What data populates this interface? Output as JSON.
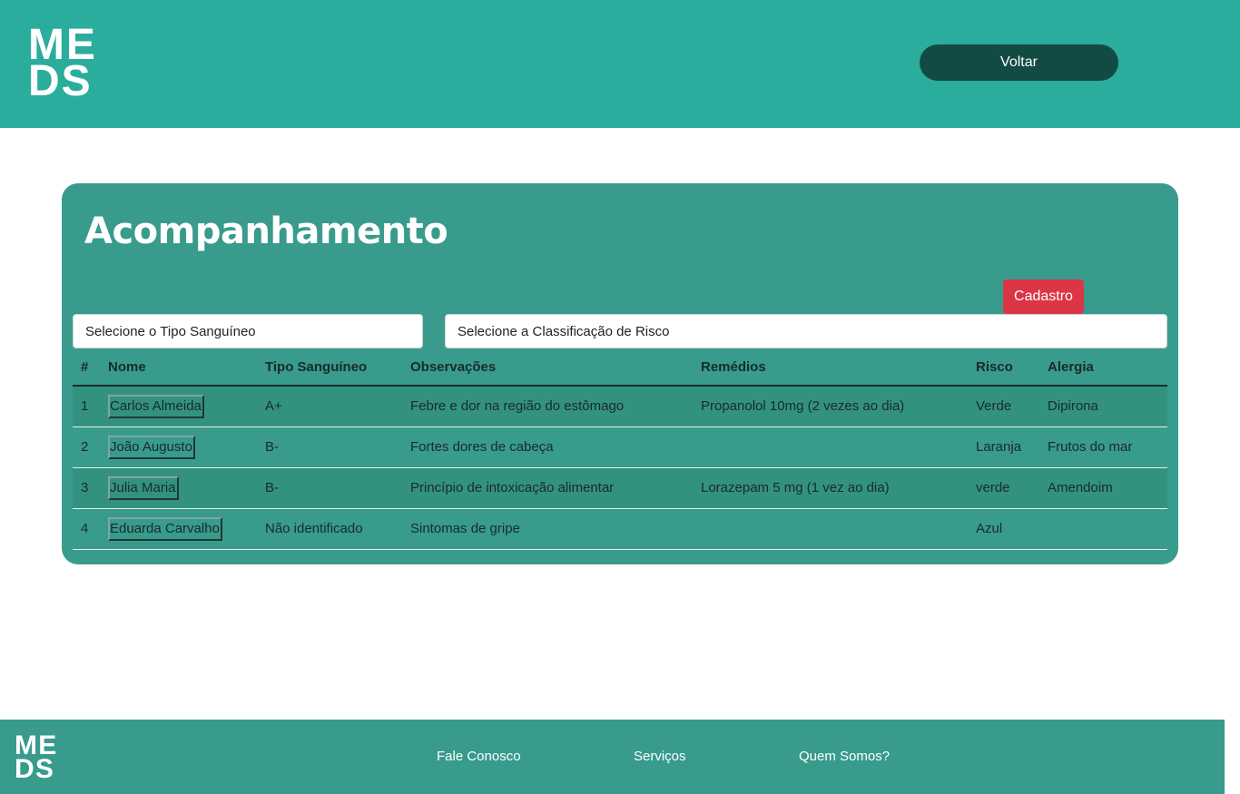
{
  "header": {
    "logo_line1": "ME",
    "logo_line2": "DS",
    "back_label": "Voltar"
  },
  "panel": {
    "title": "Acompanhamento",
    "register_label": "Cadastro",
    "blood_select_value": "Selecione o Tipo Sanguíneo",
    "risk_select_value": "Selecione a Classificação de Risco"
  },
  "table": {
    "headers": [
      "#",
      "Nome",
      "Tipo Sanguíneo",
      "Observações",
      "Remédios",
      "Risco",
      "Alergia"
    ],
    "rows": [
      {
        "n": "1",
        "name": "Carlos Almeida",
        "blood": "A+",
        "obs": "Febre e dor na região do estômago",
        "meds": "Propanolol 10mg (2 vezes ao dia)",
        "risk": "Verde",
        "allergy": "Dipirona"
      },
      {
        "n": "2",
        "name": "João Augusto",
        "blood": "B-",
        "obs": "Fortes dores de cabeça",
        "meds": "",
        "risk": "Laranja",
        "allergy": "Frutos do mar"
      },
      {
        "n": "3",
        "name": "Julia Maria",
        "blood": "B-",
        "obs": "Princípio de intoxicação alimentar",
        "meds": "Lorazepam 5 mg (1 vez ao dia)",
        "risk": "verde",
        "allergy": "Amendoim"
      },
      {
        "n": "4",
        "name": "Eduarda Carvalho",
        "blood": "Não identificado",
        "obs": "Sintomas de gripe",
        "meds": "",
        "risk": "Azul",
        "allergy": ""
      }
    ]
  },
  "footer": {
    "logo_line1": "ME",
    "logo_line2": "DS",
    "links": [
      "Fale Conosco",
      "Serviços",
      "Quem Somos?"
    ]
  },
  "colors": {
    "header_bg": "#2aad9c",
    "panel_bg": "#389b8c",
    "back_button": "#124b43",
    "register_button": "#dc3545"
  }
}
